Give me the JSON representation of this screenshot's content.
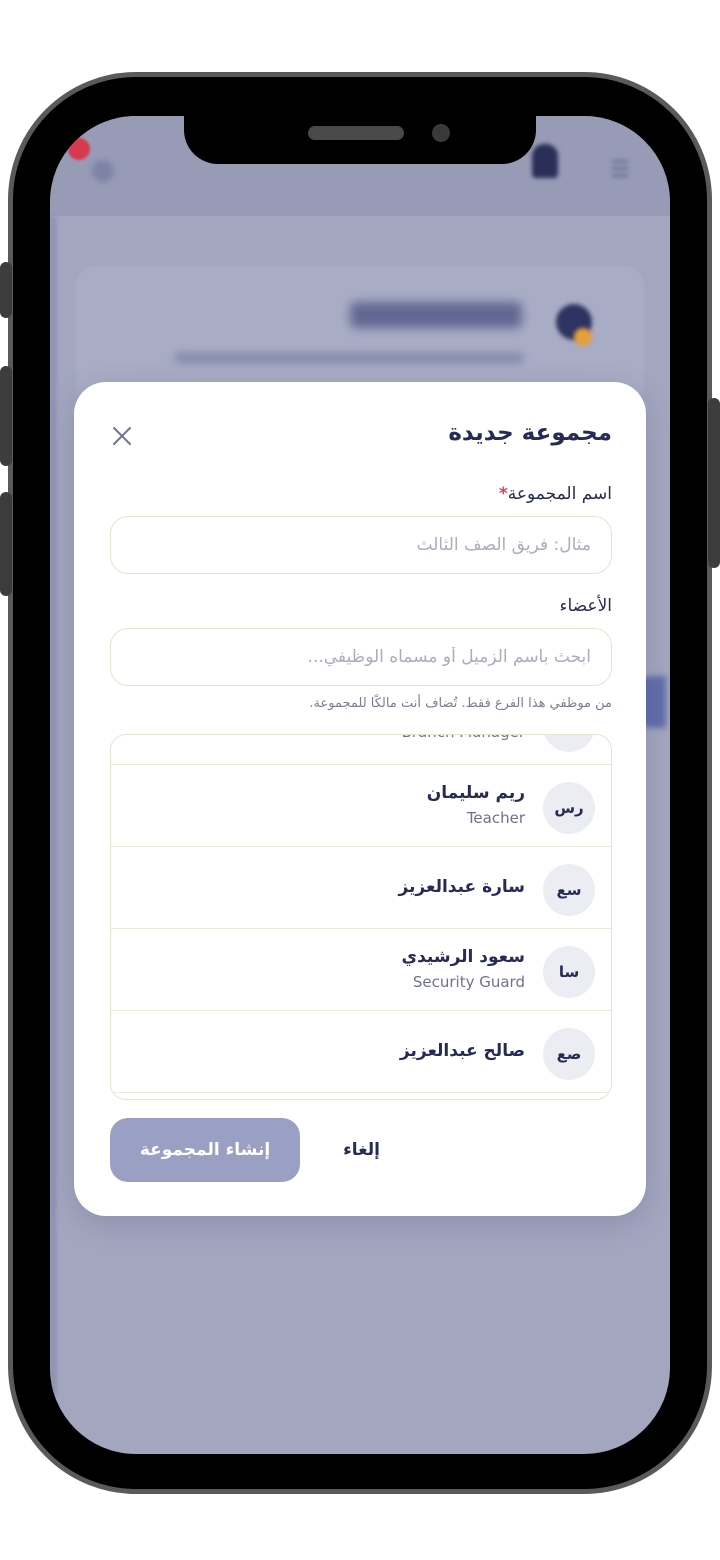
{
  "modal": {
    "title": "مجموعة جديدة",
    "group_name_label": "اسم المجموعة",
    "required_mark": "*",
    "group_name_placeholder": "مثال: فريق الصف الثالث",
    "group_name_value": "",
    "members_label": "الأعضاء",
    "members_search_placeholder": "ابحث باسم الزميل أو مسماه الوظيفي...",
    "members_search_value": "",
    "hint": "من موظفي هذا الفرع فقط. تُضاف أنت مالكًا للمجموعة.",
    "members": [
      {
        "initials": "",
        "name": "",
        "role": "Branch Manager"
      },
      {
        "initials": "رس",
        "name": "ريم سليمان",
        "role": "Teacher"
      },
      {
        "initials": "سع",
        "name": "سارة عبدالعزيز",
        "role": ""
      },
      {
        "initials": "سا",
        "name": "سعود الرشيدي",
        "role": "Security Guard"
      },
      {
        "initials": "صع",
        "name": "صالح عبدالعزيز",
        "role": ""
      }
    ],
    "create_label": "إنشاء المجموعة",
    "cancel_label": "إلغاء"
  },
  "colors": {
    "accent_navy": "#262b55",
    "required_red": "#e4405a",
    "button_disabled": "#9aa0c4",
    "overlay": "#a2a6bf"
  },
  "icons": [
    "close-icon",
    "notification-bell-icon",
    "menu-icon",
    "settings-icon"
  ]
}
